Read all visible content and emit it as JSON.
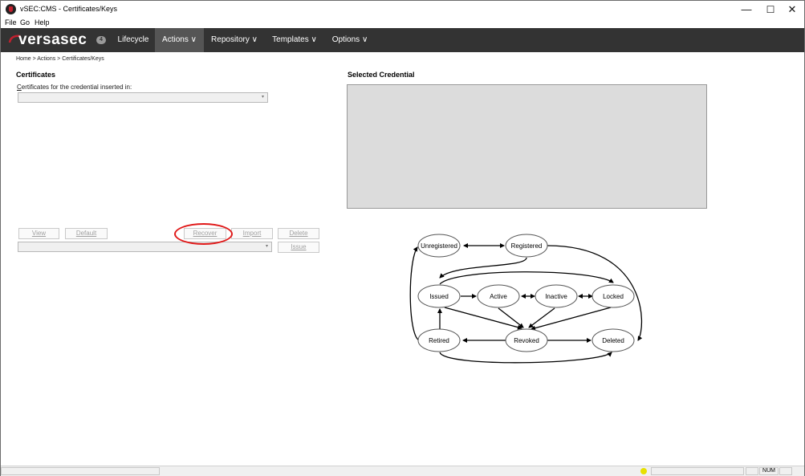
{
  "window": {
    "title": "vSEC:CMS - Certificates/Keys",
    "min_glyph": "—",
    "max_glyph": "☐",
    "close_glyph": "✕"
  },
  "menu": [
    "File",
    "Go",
    "Help"
  ],
  "nav": {
    "logo": "versasec",
    "badge": "4",
    "items": [
      "Lifecycle",
      "Actions ∨",
      "Repository ∨",
      "Templates ∨",
      "Options ∨"
    ],
    "active_index": 1
  },
  "breadcrumb": "Home > Actions > Certificates/Keys",
  "certificates": {
    "title": "Certificates",
    "label": "Certificates for the credential inserted in:",
    "label_accel": "C",
    "label_rest": "ertificates for the credential inserted in:",
    "combo_value": ""
  },
  "buttons": {
    "view": "View",
    "default": "Default",
    "recover": "Recover",
    "import": "Import",
    "delete": "Delete",
    "issue": "Issue"
  },
  "selected_credential": {
    "title": "Selected Credential"
  },
  "lifecycle": {
    "states": [
      "Unregistered",
      "Registered",
      "Issued",
      "Active",
      "Inactive",
      "Locked",
      "Retired",
      "Revoked",
      "Deleted"
    ]
  },
  "status": {
    "num": "NUM",
    "indicator_color": "#e8e000"
  },
  "colors": {
    "nav_bg": "#333333",
    "nav_active": "#555555",
    "highlight": "#e01818",
    "cred_box": "#dcdcdc"
  }
}
